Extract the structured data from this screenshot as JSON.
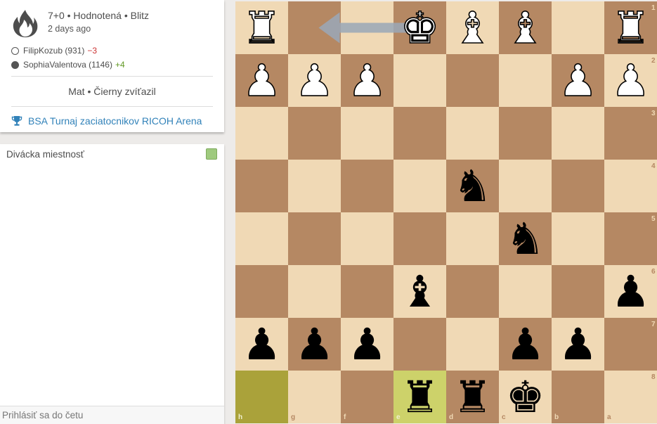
{
  "game": {
    "setup": "7+0 • Hodnotená • Blitz",
    "ago": "2 days ago",
    "players": [
      {
        "name": "FilipKozub (931)",
        "diff": "−3",
        "color": "white"
      },
      {
        "name": "SophiaValentova (1146)",
        "diff": "+4",
        "color": "black"
      }
    ],
    "result": "Mat • Čierny zvíťazil",
    "tournament": "BSA Turnaj zaciatocnikov RICOH Arena"
  },
  "chat": {
    "title": "Divácka miestnosť",
    "placeholder": "Prihlásiť sa do četu"
  },
  "board": {
    "orientation": "black",
    "colors": {
      "light": "#f0d9b5",
      "dark": "#b58863",
      "highlight_dark": "#aaa23a",
      "highlight_light": "#cdd26a",
      "arrow": "#9aa8b8"
    },
    "files": [
      "h",
      "g",
      "f",
      "e",
      "d",
      "c",
      "b",
      "a"
    ],
    "ranks": [
      "1",
      "2",
      "3",
      "4",
      "5",
      "6",
      "7",
      "8"
    ],
    "pieces": [
      {
        "square": "h1",
        "type": "rook",
        "color": "white"
      },
      {
        "square": "e1",
        "type": "king",
        "color": "white"
      },
      {
        "square": "d1",
        "type": "bishop",
        "color": "white"
      },
      {
        "square": "c1",
        "type": "bishop",
        "color": "white"
      },
      {
        "square": "a1",
        "type": "rook",
        "color": "white"
      },
      {
        "square": "h2",
        "type": "pawn",
        "color": "white"
      },
      {
        "square": "g2",
        "type": "pawn",
        "color": "white"
      },
      {
        "square": "f2",
        "type": "pawn",
        "color": "white"
      },
      {
        "square": "b2",
        "type": "pawn",
        "color": "white"
      },
      {
        "square": "a2",
        "type": "pawn",
        "color": "white"
      },
      {
        "square": "d4",
        "type": "knight",
        "color": "black"
      },
      {
        "square": "c5",
        "type": "knight",
        "color": "black"
      },
      {
        "square": "e6",
        "type": "bishop",
        "color": "black"
      },
      {
        "square": "a6",
        "type": "pawn",
        "color": "black"
      },
      {
        "square": "h7",
        "type": "pawn",
        "color": "black"
      },
      {
        "square": "g7",
        "type": "pawn",
        "color": "black"
      },
      {
        "square": "f7",
        "type": "pawn",
        "color": "black"
      },
      {
        "square": "c7",
        "type": "pawn",
        "color": "black"
      },
      {
        "square": "b7",
        "type": "pawn",
        "color": "black"
      },
      {
        "square": "e8",
        "type": "rook",
        "color": "black"
      },
      {
        "square": "d8",
        "type": "rook",
        "color": "black"
      },
      {
        "square": "c8",
        "type": "king",
        "color": "black"
      }
    ],
    "highlighted_squares": [
      "h8",
      "e8"
    ],
    "arrow": {
      "from": "e1",
      "to": "g1"
    }
  }
}
